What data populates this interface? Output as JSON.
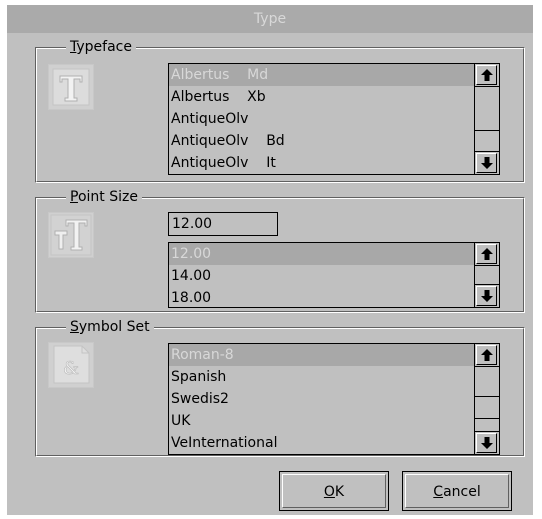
{
  "dialog": {
    "title": "Type"
  },
  "typeface": {
    "label_key": "T",
    "label_rest": "ypeface",
    "items": [
      "Albertus    Md",
      "Albertus    Xb",
      "AntiqueOlv",
      "AntiqueOlv    Bd",
      "AntiqueOlv    It"
    ],
    "selected_index": 0,
    "icon": "typeface-T-icon"
  },
  "point_size": {
    "label_key": "P",
    "label_rest": "oint Size",
    "value": "12.00",
    "items": [
      "12.00",
      "14.00",
      "18.00"
    ],
    "selected_index": 0,
    "icon": "point-size-tT-icon"
  },
  "symbol_set": {
    "label_key": "S",
    "label_rest": "ymbol Set",
    "items": [
      "Roman-8",
      "Spanish",
      "Swedis2",
      "UK",
      "VeInternational"
    ],
    "selected_index": 0,
    "icon": "ampersand-icon"
  },
  "buttons": {
    "ok_key": "O",
    "ok_rest": "K",
    "cancel_key": "C",
    "cancel_rest": "ancel"
  },
  "icons": {
    "scroll_up": "arrow-up-icon",
    "scroll_down": "arrow-down-icon"
  }
}
